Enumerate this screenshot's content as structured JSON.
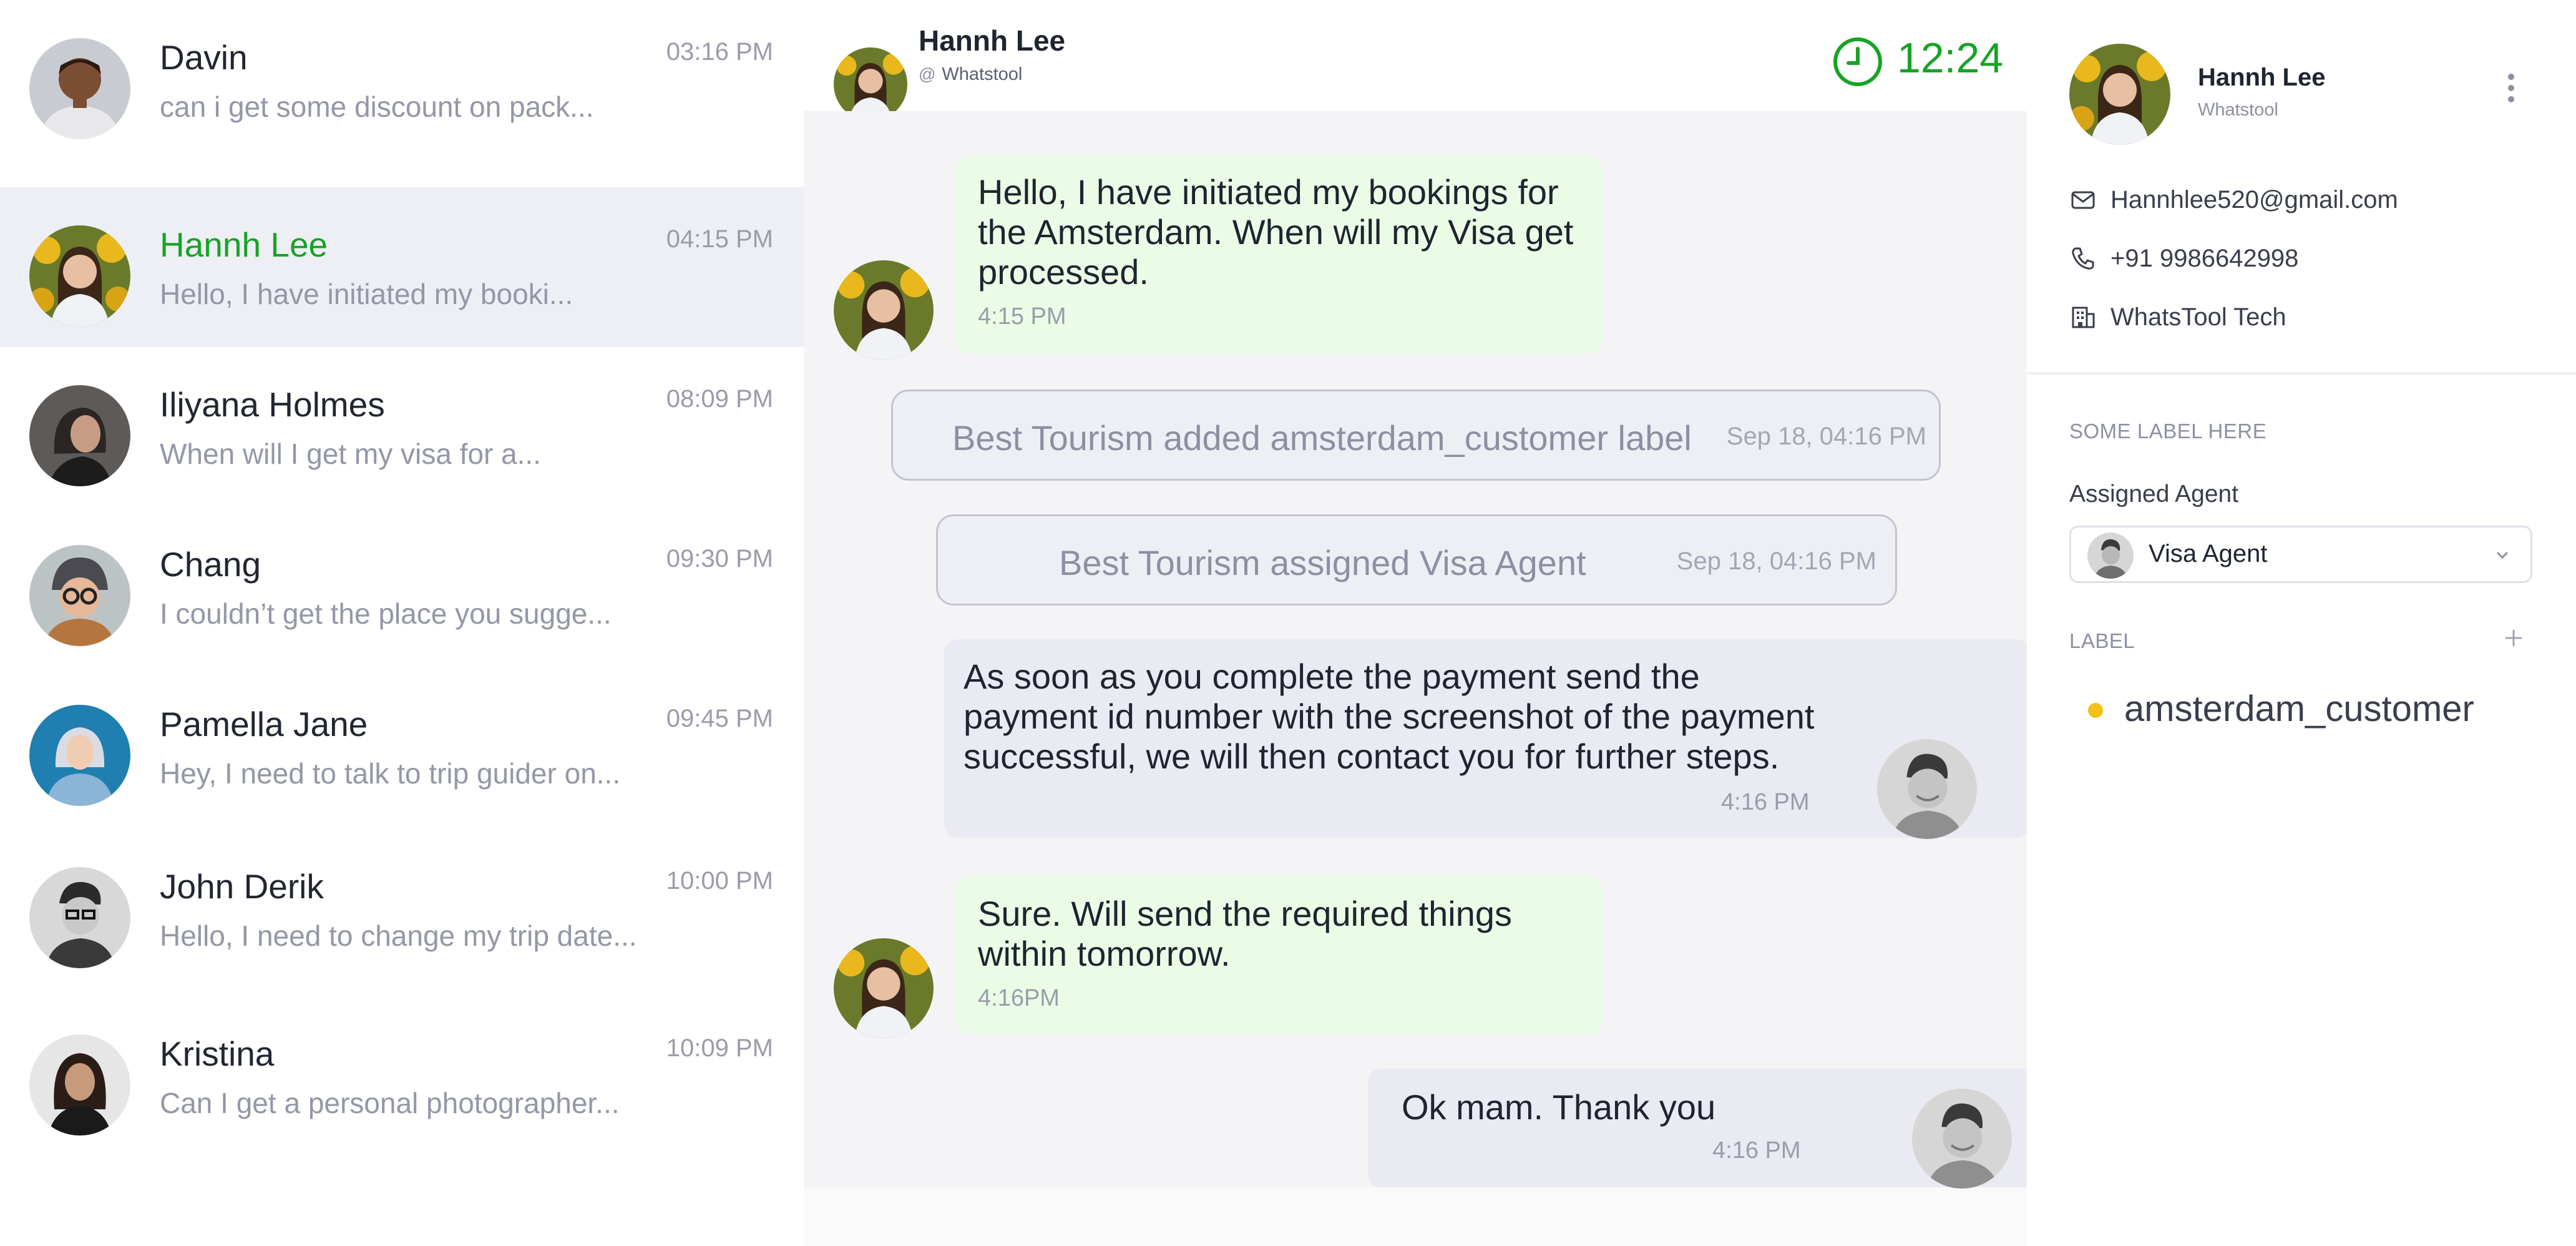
{
  "conversations": [
    {
      "name": "Davin",
      "preview": "can i get some discount on pack...",
      "time": "03:16 PM",
      "active": false
    },
    {
      "name": "Hannh Lee",
      "preview": "Hello, I have initiated my booki...",
      "time": "04:15 PM",
      "active": true
    },
    {
      "name": "Iliyana Holmes",
      "preview": "When will I get my visa for a...",
      "time": "08:09 PM",
      "active": false
    },
    {
      "name": "Chang",
      "preview": "I couldn’t get the place you sugge...",
      "time": "09:30 PM",
      "active": false
    },
    {
      "name": "Pamella Jane",
      "preview": "Hey, I need to talk to trip guider on...",
      "time": "09:45 PM",
      "active": false
    },
    {
      "name": "John Derik",
      "preview": "Hello, I need to change my trip date...",
      "time": "10:00 PM",
      "active": false
    },
    {
      "name": "Kristina",
      "preview": "Can I get a personal photographer...",
      "time": "10:09 PM",
      "active": false
    }
  ],
  "chat": {
    "contact_name": "Hannh Lee",
    "source_icon": "at-icon",
    "source_symbol": "@",
    "source": "Whatstool",
    "timer": "12:24",
    "accent_color": "#17a325",
    "messages": [
      {
        "direction": "incoming",
        "text": "Hello, I have initiated my bookings for the Amsterdam. When will my Visa get processed.",
        "time": "4:15 PM"
      },
      {
        "direction": "outgoing",
        "text": "As soon as you complete the payment send the payment id number with the screenshot of the payment successful, we will then contact you for further steps.",
        "time": "4:16 PM"
      },
      {
        "direction": "incoming",
        "text": "Sure. Will send the required things within tomorrow.",
        "time": "4:16PM"
      },
      {
        "direction": "outgoing",
        "text": "Ok mam. Thank you",
        "time": "4:16 PM"
      }
    ],
    "system_events": [
      {
        "text": "Best Tourism added amsterdam_customer label",
        "date": "Sep 18, 04:16 PM"
      },
      {
        "text": "Best Tourism assigned Visa Agent",
        "date": "Sep 18, 04:16 PM"
      }
    ]
  },
  "contact": {
    "name": "Hannh Lee",
    "sub": "Whatstool",
    "email": "Hannhlee520@gmail.com",
    "phone": "+91 9986642998",
    "company": "WhatsTool Tech",
    "section_heading": "SOME LABEL HERE",
    "assigned_agent_label": "Assigned Agent",
    "assigned_agent": "Visa Agent",
    "label_heading": "LABEL",
    "label": "amsterdam_customer",
    "label_color": "#f2c21b"
  }
}
